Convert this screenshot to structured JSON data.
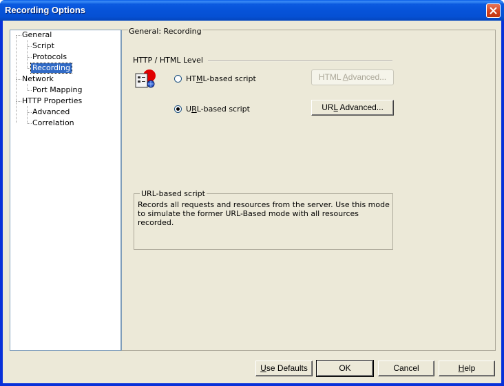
{
  "window": {
    "title": "Recording Options"
  },
  "tree": {
    "items": [
      {
        "label": "General",
        "level": 0
      },
      {
        "label": "Script",
        "level": 1
      },
      {
        "label": "Protocols",
        "level": 1
      },
      {
        "label": "Recording",
        "level": 1,
        "selected": true
      },
      {
        "label": "Network",
        "level": 0
      },
      {
        "label": "Port Mapping",
        "level": 1
      },
      {
        "label": "HTTP Properties",
        "level": 0
      },
      {
        "label": "Advanced",
        "level": 1
      },
      {
        "label": "Correlation",
        "level": 1
      }
    ]
  },
  "panel": {
    "title": "General: Recording",
    "section_label": "HTTP / HTML Level",
    "options": [
      {
        "label_pre": "HT",
        "label_mnemonic": "M",
        "label_post": "L-based script",
        "selected": false
      },
      {
        "label_pre": "U",
        "label_mnemonic": "R",
        "label_post": "L-based script",
        "selected": true
      }
    ],
    "html_advanced": {
      "label_pre": "HTML ",
      "label_mnemonic": "A",
      "label_post": "dvanced...",
      "enabled": false
    },
    "url_advanced": {
      "label_pre": "UR",
      "label_mnemonic": "L",
      "label_post": " Advanced...",
      "enabled": true
    },
    "description": {
      "title": "URL-based script",
      "text": "Records all requests and resources from the server. Use this mode to simulate the former URL-Based mode with all resources recorded."
    }
  },
  "footer": {
    "use_defaults": {
      "mnemonic": "U",
      "rest": "se Defaults"
    },
    "ok": "OK",
    "cancel": "Cancel",
    "help": {
      "mnemonic": "H",
      "rest": "elp"
    }
  },
  "colors": {
    "title_bar": "#0653d9",
    "selection": "#316ac5",
    "dialog_bg": "#ece9d8"
  }
}
